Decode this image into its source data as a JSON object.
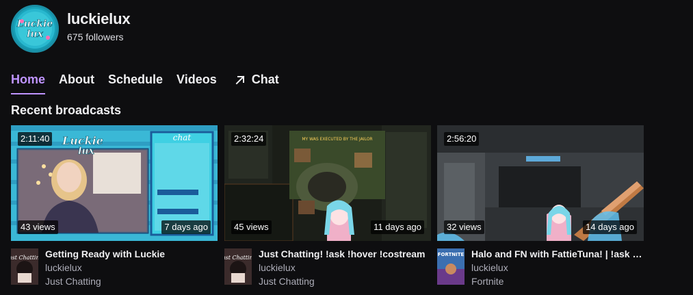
{
  "channel": {
    "name": "luckielux",
    "followers": "675 followers",
    "avatar_text": "Luckie lux"
  },
  "nav": {
    "tabs": [
      "Home",
      "About",
      "Schedule",
      "Videos"
    ],
    "chat_label": "Chat",
    "active": "Home"
  },
  "section_title": "Recent broadcasts",
  "colors": {
    "accent": "#bf94ff",
    "background": "#0e0e10",
    "muted_text": "#adadb8"
  },
  "broadcasts": [
    {
      "duration": "2:11:40",
      "views": "43 views",
      "age": "7 days ago",
      "title": "Getting Ready with Luckie",
      "streamer": "luckielux",
      "game": "Just Chatting",
      "game_art_text": "Just Chatting"
    },
    {
      "duration": "2:32:24",
      "views": "45 views",
      "age": "11 days ago",
      "title": "Just Chatting! !ask !hover !costream",
      "streamer": "luckielux",
      "game": "Just Chatting",
      "game_art_text": "Just Chatting"
    },
    {
      "duration": "2:56:20",
      "views": "32 views",
      "age": "14 days ago",
      "title": "Halo and FN with FattieTuna! | !ask !hover !costream",
      "streamer": "luckielux",
      "game": "Fortnite",
      "game_art_text": "FORTNITE"
    }
  ]
}
